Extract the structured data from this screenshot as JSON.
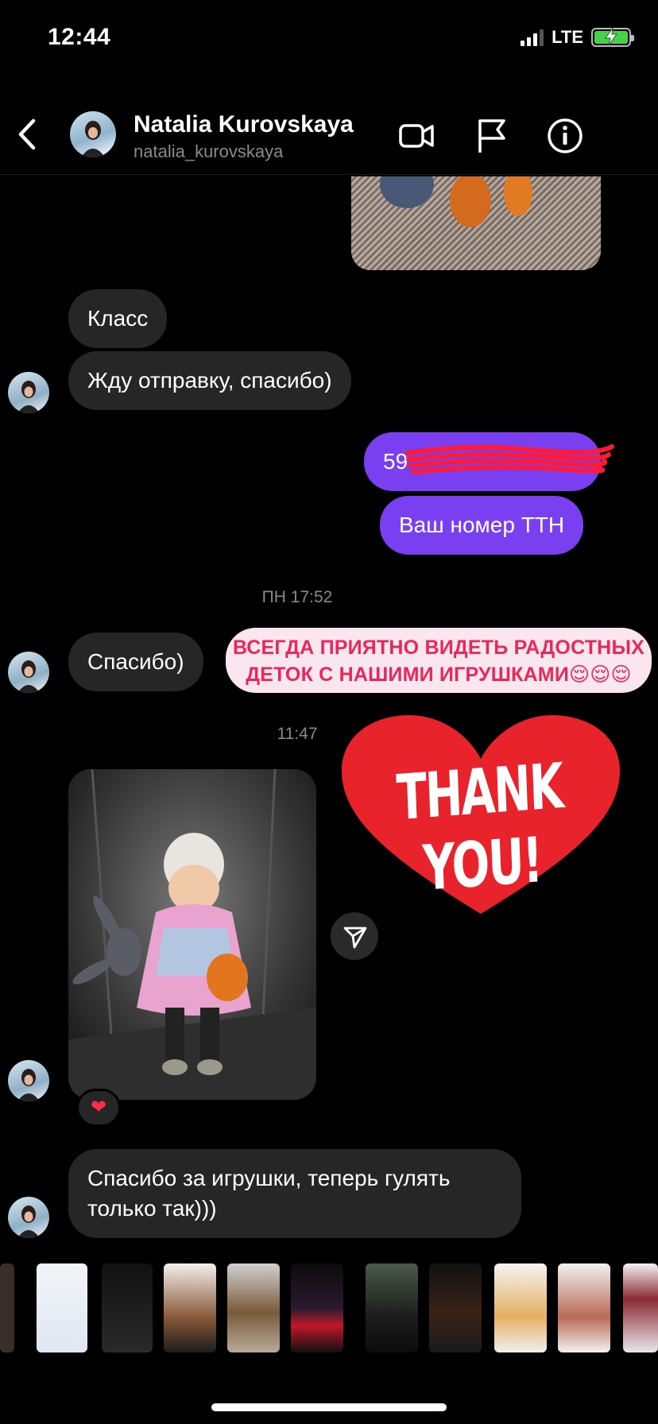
{
  "status_bar": {
    "time": "12:44",
    "network": "LTE",
    "battery_charging": true
  },
  "header": {
    "name": "Natalia Kurovskaya",
    "handle": "natalia_kurovskaya",
    "icons": [
      "back-icon",
      "video-call-icon",
      "flag-icon",
      "info-icon"
    ]
  },
  "messages": {
    "in_1": "Класс",
    "in_2": "Жду отправку, спасибо)",
    "out_1": "59",
    "out_2": "Ваш номер ТТН",
    "time_1": "ПН 17:52",
    "in_3": "Спасибо)",
    "banner_line1": "ВСЕГДА ПРИЯТНО ВИДЕТЬ РАДОСТНЫХ",
    "banner_line2": "ДЕТОК С НАШИМИ ИГРУШКАМИ😌😌😌",
    "time_2": "11:47",
    "sticker_text": "THANK YOU!",
    "reaction": "❤️",
    "in_4_line1": "Спасибо за игрушки, теперь гулять",
    "in_4_line2": "только так)))"
  },
  "colors": {
    "outgoing": "#7b3ff2",
    "incoming": "#262626",
    "banner_text": "#e8285a",
    "heart": "#e8232b"
  }
}
